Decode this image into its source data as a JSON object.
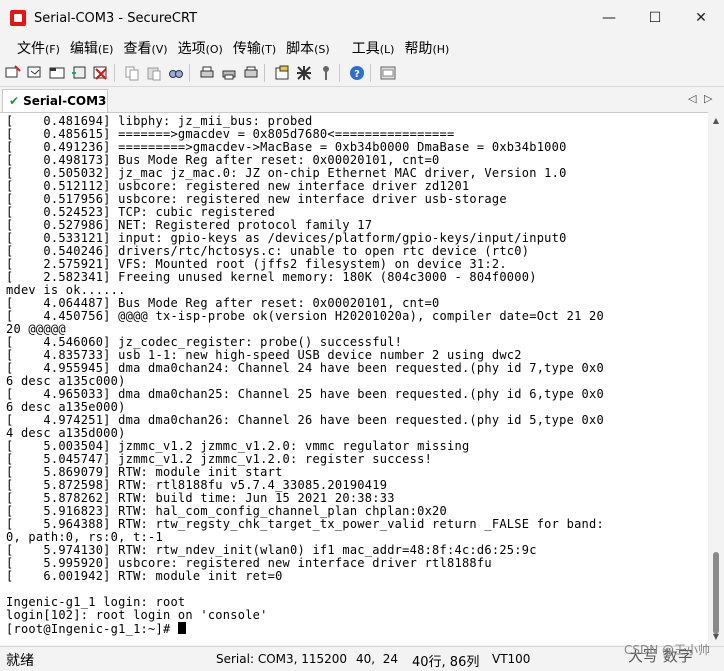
{
  "window": {
    "title": "Serial-COM3 - SecureCRT",
    "minimize_glyph": "—",
    "maximize_glyph": "☐",
    "close_glyph": "✕"
  },
  "menu": [
    {
      "label": "文件",
      "acc": "(F)"
    },
    {
      "label": "编辑",
      "acc": "(E)"
    },
    {
      "label": "查看",
      "acc": "(V)"
    },
    {
      "label": "选项",
      "acc": "(O)"
    },
    {
      "label": "传输",
      "acc": "(T)"
    },
    {
      "label": "脚本",
      "acc": "(S)"
    },
    {
      "label": "工具",
      "acc": "(L)"
    },
    {
      "label": "帮助",
      "acc": "(H)"
    }
  ],
  "toolbar_icons": [
    "connect-icon",
    "quick-connect-icon",
    "connect-tab-icon",
    "reconnect-icon",
    "disconnect-icon",
    "copy-icon",
    "paste-icon",
    "find-icon",
    "print-setup-icon",
    "print-icon",
    "print-screen-icon",
    "session-options-icon",
    "global-options-icon",
    "keymap-icon",
    "help-icon",
    "sftp-icon"
  ],
  "tab": {
    "label": "Serial-COM3",
    "check": "✔",
    "prev": "◁",
    "next": "▷",
    "close": "✕"
  },
  "terminal": {
    "lines": [
      "[    0.481694] libphy: jz_mii_bus: probed",
      "[    0.485615] =======>gmacdev = 0x805d7680<================",
      "[    0.491236] =========>gmacdev->MacBase = 0xb34b0000 DmaBase = 0xb34b1000",
      "[    0.498173] Bus Mode Reg after reset: 0x00020101, cnt=0",
      "[    0.505032] jz_mac jz_mac.0: JZ on-chip Ethernet MAC driver, Version 1.0",
      "[    0.512112] usbcore: registered new interface driver zd1201",
      "[    0.517956] usbcore: registered new interface driver usb-storage",
      "[    0.524523] TCP: cubic registered",
      "[    0.527986] NET: Registered protocol family 17",
      "[    0.533121] input: gpio-keys as /devices/platform/gpio-keys/input/input0",
      "[    0.540246] drivers/rtc/hctosys.c: unable to open rtc device (rtc0)",
      "[    2.575921] VFS: Mounted root (jffs2 filesystem) on device 31:2.",
      "[    2.582341] Freeing unused kernel memory: 180K (804c3000 - 804f0000)",
      "mdev is ok......",
      "[    4.064487] Bus Mode Reg after reset: 0x00020101, cnt=0",
      "[    4.450756] @@@@ tx-isp-probe ok(version H20201020a), compiler date=Oct 21 20",
      "20 @@@@@",
      "[    4.546060] jz_codec_register: probe() successful!",
      "[    4.835733] usb 1-1: new high-speed USB device number 2 using dwc2",
      "[    4.955945] dma dma0chan24: Channel 24 have been requested.(phy id 7,type 0x0",
      "6 desc a135c000)",
      "[    4.965033] dma dma0chan25: Channel 25 have been requested.(phy id 6,type 0x0",
      "6 desc a135e000)",
      "[    4.974251] dma dma0chan26: Channel 26 have been requested.(phy id 5,type 0x0",
      "4 desc a135d000)",
      "[    5.003504] jzmmc_v1.2 jzmmc_v1.2.0: vmmc regulator missing",
      "[    5.045747] jzmmc_v1.2 jzmmc_v1.2.0: register success!",
      "[    5.869079] RTW: module init start",
      "[    5.872598] RTW: rtl8188fu v5.7.4_33085.20190419",
      "[    5.878262] RTW: build time: Jun 15 2021 20:38:33",
      "[    5.916823] RTW: hal_com_config_channel_plan chplan:0x20",
      "[    5.964388] RTW: rtw_regsty_chk_target_tx_power_valid return _FALSE for band:",
      "0, path:0, rs:0, t:-1",
      "[    5.974130] RTW: rtw_ndev_init(wlan0) if1 mac_addr=48:8f:4c:d6:25:9c",
      "[    5.995920] usbcore: registered new interface driver rtl8188fu",
      "[    6.001942] RTW: module init ret=0",
      "",
      "Ingenic-g1_1 login: root",
      "login[102]: root login on 'console'",
      "[root@Ingenic-g1_1:~]# "
    ]
  },
  "status": {
    "ready": "就绪",
    "connection": "Serial: COM3, 115200",
    "cursor_pos": "40,  24",
    "size": "40行, 86列",
    "emulation": "VT100",
    "watermark": "CSDN @王小帅",
    "overlay": "大写  数字"
  }
}
